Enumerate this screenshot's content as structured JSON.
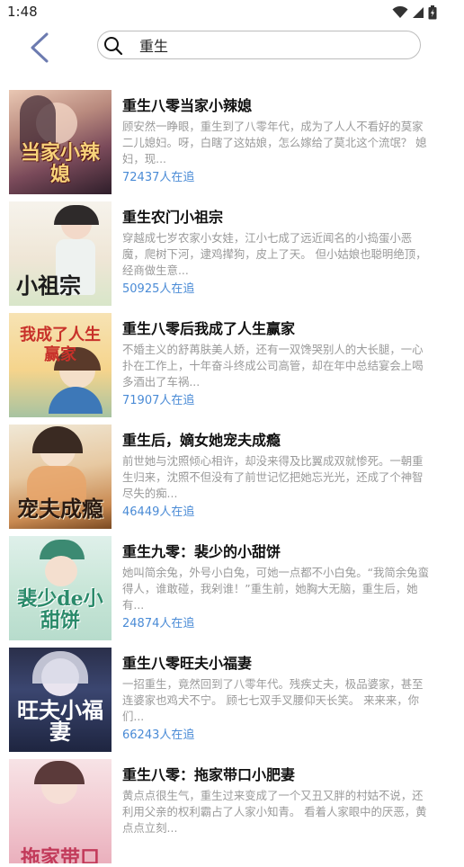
{
  "status_bar": {
    "time": "1:48"
  },
  "search": {
    "value": "重生"
  },
  "colors": {
    "accent": "#4a8bd6",
    "back_arrow": "#6c7bb0"
  },
  "books": [
    {
      "title": "重生八零当家小辣媳",
      "desc": "顾安然一睁眼，重生到了八零年代，成为了人人不看好的莫家二儿媳妇。呀，白瞎了这姑娘，怎么嫁给了莫北这个流氓？ 媳妇，现...",
      "readers": "72437人在追",
      "cover_text": "当家小辣媳"
    },
    {
      "title": "重生农门小祖宗",
      "desc": "穿越成七岁农家小女娃，江小七成了远近闻名的小捣蛋小恶魔，爬树下河，逮鸡撵狗，皮上了天。 但小姑娘也聪明绝顶，经商做生意...",
      "readers": "50925人在追",
      "cover_text": "小祖宗"
    },
    {
      "title": "重生八零后我成了人生赢家",
      "desc": "不婚主义的舒苒肤美人娇，还有一双馋哭别人的大长腿，一心扑在工作上，十年奋斗终成公司高管，却在年中总结宴会上喝多酒出了车祸...",
      "readers": "71907人在追",
      "cover_text": "我成了人生赢家"
    },
    {
      "title": "重生后，嫡女她宠夫成瘾",
      "desc": "前世她与沈照倾心相许，却没来得及比翼成双就惨死。一朝重生归来，沈照不但没有了前世记忆把她忘光光，还成了个神智尽失的痴...",
      "readers": "46449人在追",
      "cover_text": "宠夫成瘾"
    },
    {
      "title": "重生九零：裴少的小甜饼",
      "desc": "她叫简余兔，外号小白兔，可她一点都不小白兔。“我简余兔蛮得人，谁敢碰，我剁谁！”重生前，她胸大无脑，重生后，她有...",
      "readers": "24874人在追",
      "cover_text": "裴少de小甜饼"
    },
    {
      "title": "重生八零旺夫小福妻",
      "desc": "一招重生，竟然回到了八零年代。残疾丈夫，极品婆家，甚至连婆家也鸡犬不宁。 顾七七双手叉腰仰天长笑。 来来来，你们...",
      "readers": "66243人在追",
      "cover_text": "旺夫小福妻"
    },
    {
      "title": "重生八零：拖家带口小肥妻",
      "desc": "黄点点很生气，重生过来变成了一个又丑又胖的村姑不说，还利用父亲的权利霸占了人家小知青。 看着人家眼中的厌恶，黄点点立刻...",
      "readers": "",
      "cover_text": "拖家带口"
    }
  ]
}
